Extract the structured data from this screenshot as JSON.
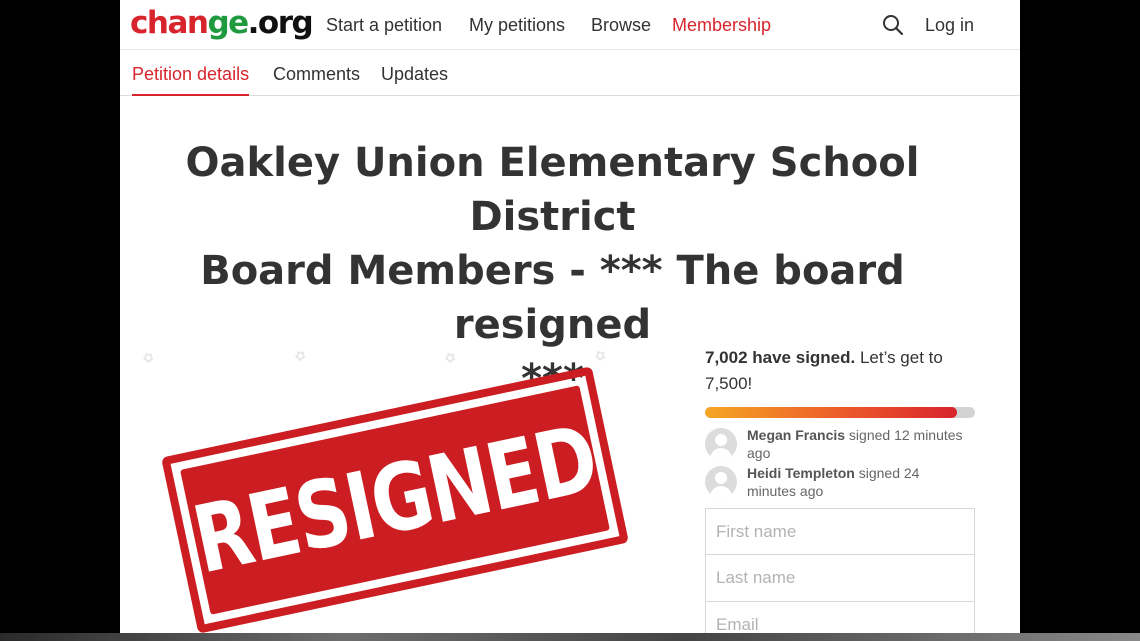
{
  "nav": {
    "logo": "change.org",
    "links": [
      "Start a petition",
      "My petitions",
      "Browse",
      "Membership"
    ],
    "login": "Log in"
  },
  "subnav": {
    "tabs": [
      "Petition details",
      "Comments",
      "Updates"
    ]
  },
  "petition": {
    "title_line1": "Oakley Union Elementary School District",
    "title_line2": "Board Members - *** The board resigned",
    "title_line3": "***",
    "image_text": "RESIGNED"
  },
  "sign": {
    "count": "7,002 have signed.",
    "goal_text": " Let’s get to 7,500!",
    "progress_fraction": 0.934,
    "recent": [
      {
        "name": "Megan Francis",
        "action": " signed 12 minutes ago"
      },
      {
        "name": "Heidi Templeton",
        "action": " signed 24 minutes ago"
      }
    ],
    "first_name_placeholder": "First name",
    "last_name_placeholder": "Last name",
    "email_placeholder": "Email"
  },
  "colors": {
    "brand_red": "#d8242c",
    "logo_green": "#1f9a3f"
  }
}
